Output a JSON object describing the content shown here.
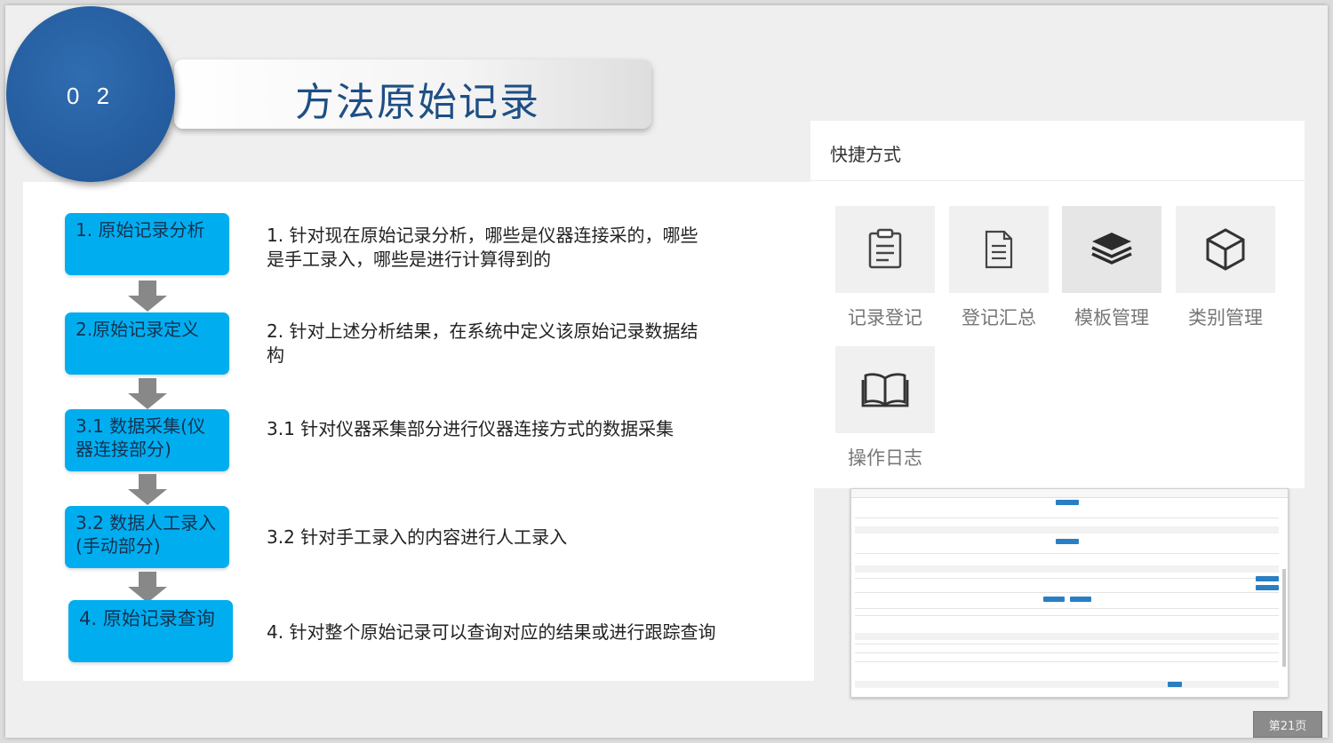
{
  "section_number": "0 2",
  "title": "方法原始记录",
  "steps": [
    {
      "label": "1. 原始记录分析",
      "desc": "1. 针对现在原始记录分析，哪些是仪器连接采的，哪些是手工录入，哪些是进行计算得到的"
    },
    {
      "label": "2.原始记录定义",
      "desc": "2. 针对上述分析结果，在系统中定义该原始记录数据结构"
    },
    {
      "label": "3.1 数据采集(仪器连接部分)",
      "desc": "3.1 针对仪器采集部分进行仪器连接方式的数据采集"
    },
    {
      "label": "3.2 数据人工录入(手动部分)",
      "desc": "3.2 针对手工录入的内容进行人工录入"
    },
    {
      "label": "4. 原始记录查询",
      "desc": "4. 针对整个原始记录可以查询对应的结果或进行跟踪查询"
    }
  ],
  "shortcuts": {
    "title": "快捷方式",
    "items": [
      {
        "label": "记录登记",
        "icon": "clipboard-icon"
      },
      {
        "label": "登记汇总",
        "icon": "document-list-icon"
      },
      {
        "label": "模板管理",
        "icon": "layers-icon"
      },
      {
        "label": "类别管理",
        "icon": "cube-icon"
      },
      {
        "label": "操作日志",
        "icon": "book-icon"
      }
    ]
  },
  "page_indicator": "第21页",
  "colors": {
    "circle": "#245c9e",
    "title_text": "#1e4f85",
    "step_fill": "#00aef0",
    "arrow": "#888888"
  }
}
